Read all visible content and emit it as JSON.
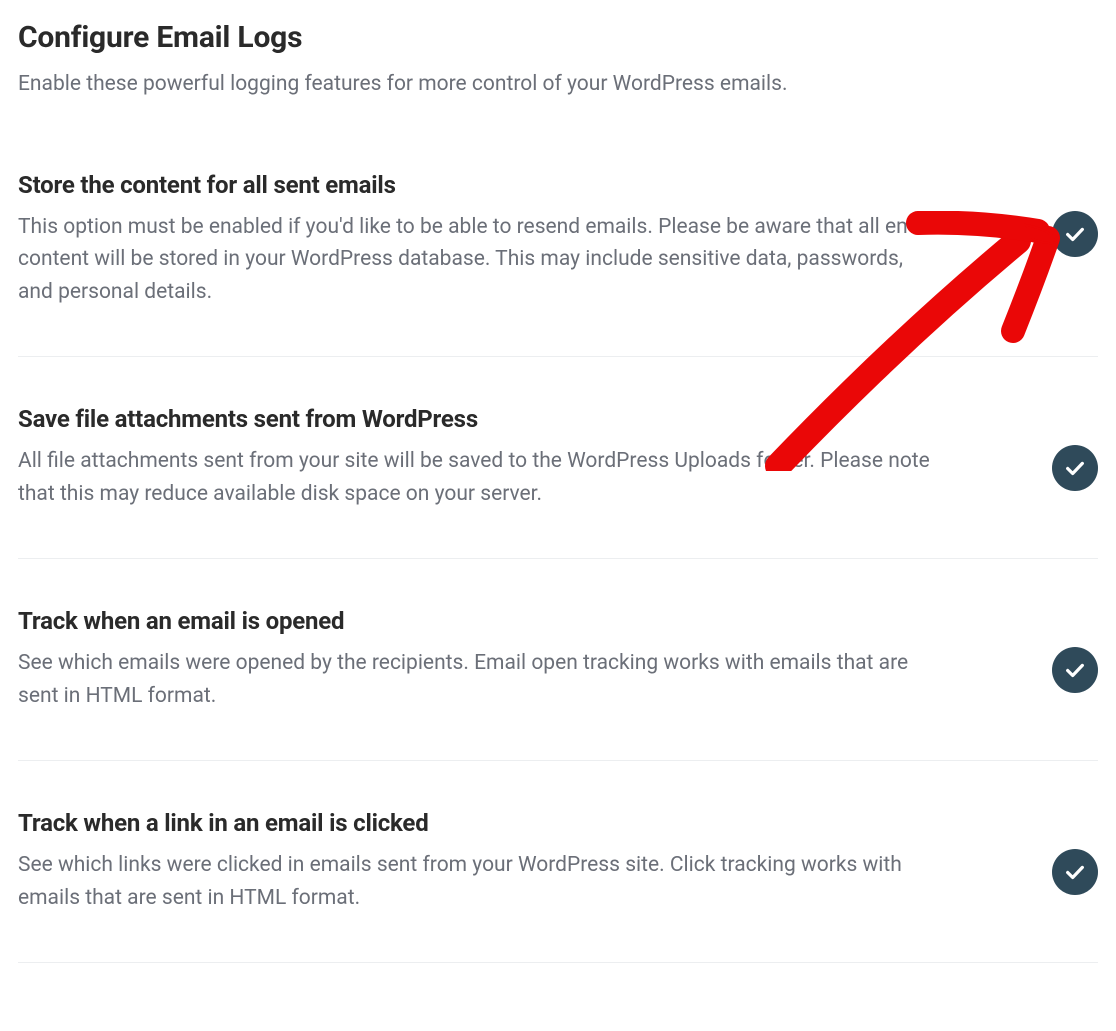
{
  "page": {
    "title": "Configure Email Logs",
    "subtitle": "Enable these powerful logging features for more control of your WordPress emails."
  },
  "options": [
    {
      "title": "Store the content for all sent emails",
      "description": "This option must be enabled if you'd like to be able to resend emails. Please be aware that all email content will be stored in your WordPress database. This may include sensitive data, passwords, and personal details.",
      "checked": true
    },
    {
      "title": "Save file attachments sent from WordPress",
      "description": "All file attachments sent from your site will be saved to the WordPress Uploads folder. Please note that this may reduce available disk space on your server.",
      "checked": true
    },
    {
      "title": "Track when an email is opened",
      "description": "See which emails were opened by the recipients. Email open tracking works with emails that are sent in HTML format.",
      "checked": true
    },
    {
      "title": "Track when a link in an email is clicked",
      "description": "See which links were clicked in emails sent from your WordPress site. Click tracking works with emails that are sent in HTML format.",
      "checked": true
    }
  ],
  "colors": {
    "toggle_on": "#2f4a5a",
    "annotation": "#ea0707"
  }
}
